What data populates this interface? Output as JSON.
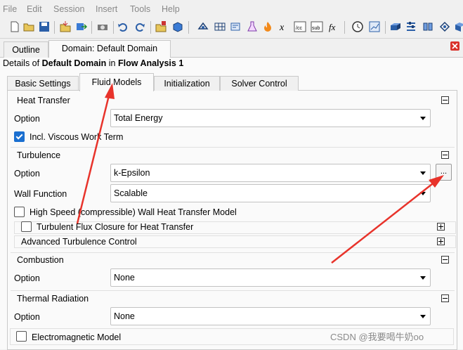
{
  "menubar": {
    "items": [
      "File",
      "Edit",
      "Session",
      "Insert",
      "Tools",
      "Help"
    ]
  },
  "tabs": {
    "outline": "Outline",
    "domain": "Domain: Default Domain"
  },
  "details": {
    "prefix": "Details of ",
    "object": "Default Domain",
    "mid": " in ",
    "analysis": "Flow Analysis 1"
  },
  "inner_tabs": [
    "Basic Settings",
    "Fluid Models",
    "Initialization",
    "Solver Control"
  ],
  "heat_transfer": {
    "title": "Heat Transfer",
    "option_label": "Option",
    "option_value": "Total Energy",
    "viscous_work_label": "Incl. Viscous Work Term",
    "viscous_work_checked": true
  },
  "turbulence": {
    "title": "Turbulence",
    "option_label": "Option",
    "option_value": "k-Epsilon",
    "ellipsis": "...",
    "wall_function_label": "Wall Function",
    "wall_function_value": "Scalable",
    "high_speed_label": "High Speed (compressible) Wall Heat Transfer Model",
    "flux_closure_label": "Turbulent Flux Closure for Heat Transfer",
    "advanced_label": "Advanced Turbulence Control"
  },
  "combustion": {
    "title": "Combustion",
    "option_label": "Option",
    "option_value": "None"
  },
  "thermal_radiation": {
    "title": "Thermal Radiation",
    "option_label": "Option",
    "option_value": "None"
  },
  "electromagnetic": {
    "label": "Electromagnetic Model"
  },
  "watermark": "CSDN @我要喝牛奶oo",
  "colors": {
    "accent": "#1a6fd0",
    "annotation_arrow": "#e8332b"
  },
  "toolbar_icons": [
    "new-icon",
    "open-icon",
    "save-icon",
    "import-icon",
    "export-icon",
    "print-icon",
    "undo-icon",
    "redo-icon",
    "insert-icon",
    "object-icon",
    "domain-icon",
    "mesh-icon",
    "flask-icon",
    "fire-icon",
    "variable-icon",
    "dcc-icon",
    "sub-icon",
    "fx-icon",
    "clock-icon",
    "graph-icon",
    "boundary-icon",
    "solver-icon",
    "connect-icon",
    "split-icon"
  ]
}
